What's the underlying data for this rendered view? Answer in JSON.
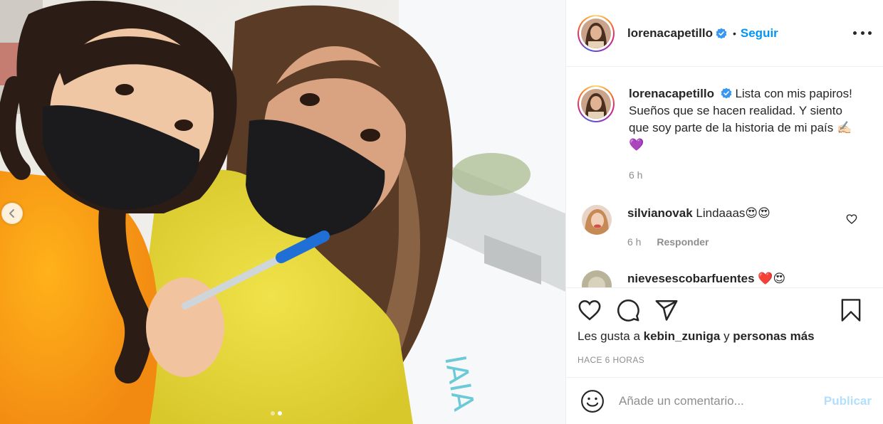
{
  "post": {
    "username": "lorenacapetillo",
    "separator": "•",
    "follow_label": "Seguir",
    "caption": "Lista con mis papiros! Sueños que se hacen realidad. Y siento que soy parte de la historia de mi país ✍🏻💜",
    "caption_time": "6 h"
  },
  "comments": [
    {
      "username": "silvianovak",
      "text": "Lindaaas😍😍",
      "time": "6 h",
      "reply_label": "Responder"
    },
    {
      "username": "nievesescobarfuentes",
      "text": "❤️😍"
    }
  ],
  "likes": {
    "prefix": "Les gusta a",
    "user": "kebin_zuniga",
    "middle": "y",
    "suffix": "personas más"
  },
  "timestamp": "HACE 6 HORAS",
  "composer": {
    "placeholder": "Añade un comentario...",
    "publish_label": "Publicar"
  },
  "icons": [
    "chevron-left-icon",
    "more-icon",
    "verified-icon",
    "heart-icon",
    "comment-icon",
    "share-icon",
    "bookmark-icon",
    "emoji-icon"
  ],
  "colors": {
    "accent": "#0095f6",
    "publish_disabled": "#b2dffc",
    "muted": "#8e8e8e"
  },
  "carousel": {
    "total": 2,
    "current": 2
  }
}
